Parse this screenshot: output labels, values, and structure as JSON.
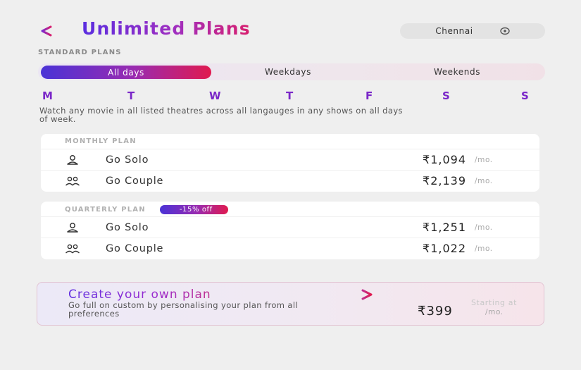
{
  "header": {
    "title": "Unlimited Plans",
    "city": "Chennai",
    "back_icon": "chevron-left-icon",
    "location_icon": "location-pin-icon"
  },
  "section_label": "STANDARD PLANS",
  "tabs": [
    {
      "label": "All days",
      "active": true
    },
    {
      "label": "Weekdays",
      "active": false
    },
    {
      "label": "Weekends",
      "active": false
    }
  ],
  "days": [
    "M",
    "T",
    "W",
    "T",
    "F",
    "S",
    "S"
  ],
  "description": "Watch any movie in all listed theatres across all langauges in any shows on all days of week.",
  "monthly": {
    "title": "MONTHLY PLAN",
    "rows": [
      {
        "icon": "user-icon",
        "label": "Go Solo",
        "price": "₹1,094",
        "unit": "/mo."
      },
      {
        "icon": "users-icon",
        "label": "Go Couple",
        "price": "₹2,139",
        "unit": "/mo."
      }
    ]
  },
  "quarterly": {
    "title": "QUARTERLY PLAN",
    "badge": "-15% off",
    "rows": [
      {
        "icon": "user-icon",
        "label": "Go Solo",
        "price": "₹1,251",
        "unit": "/mo."
      },
      {
        "icon": "users-icon",
        "label": "Go Couple",
        "price": "₹1,022",
        "unit": "/mo."
      }
    ]
  },
  "custom_plan": {
    "title": "Create your own plan",
    "description": "Go full on custom by personalising your plan from all preferences",
    "starting_label": "Starting at",
    "price": "₹399",
    "unit": "/mo.",
    "arrow_icon": "chevron-right-icon"
  },
  "colors": {
    "accent_purple": "#6a2ad6",
    "accent_pink": "#e01a4f",
    "background": "#efefef"
  }
}
